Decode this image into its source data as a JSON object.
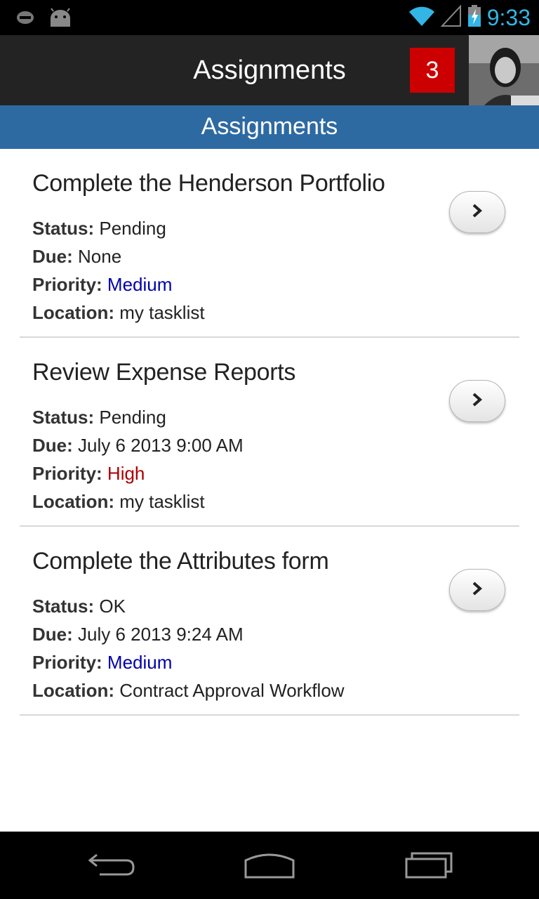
{
  "status_bar": {
    "time": "9:33",
    "icons": [
      "notification-icon",
      "android-icon",
      "wifi-icon",
      "signal-icon",
      "battery-charging-icon"
    ]
  },
  "action_bar": {
    "title": "Assignments",
    "badge_count": "3",
    "avatar": "user-photo"
  },
  "list_header": {
    "title": "Assignments"
  },
  "colors": {
    "header_blue": "#2e6aa2",
    "badge_red": "#cc0000",
    "priority_medium": "#0000aa",
    "priority_high": "#aa0000",
    "time_blue": "#33b5e5"
  },
  "labels": {
    "status": "Status:",
    "due": "Due:",
    "priority": "Priority:",
    "location": "Location:"
  },
  "tasks": [
    {
      "title": "Complete the Henderson Portfolio",
      "status": "Pending",
      "due": "None",
      "priority": "Medium",
      "location": "my tasklist"
    },
    {
      "title": "Review Expense Reports",
      "status": "Pending",
      "due": "July 6 2013 9:00 AM",
      "priority": "High",
      "location": "my tasklist"
    },
    {
      "title": "Complete the Attributes form",
      "status": "OK",
      "due": "July 6 2013 9:24 AM",
      "priority": "Medium",
      "location": "Contract Approval Workflow"
    }
  ],
  "nav_bar": {
    "buttons": [
      "back-icon",
      "home-icon",
      "recent-apps-icon"
    ]
  }
}
